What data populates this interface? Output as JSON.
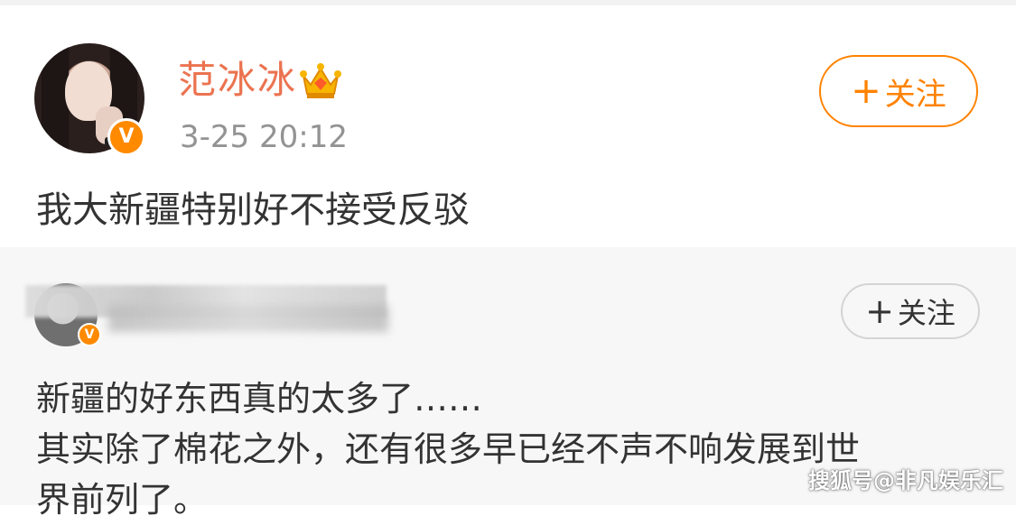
{
  "post": {
    "username": "范冰冰",
    "timestamp": "3-25 20:12",
    "follow_label": "关注",
    "follow_plus": "+",
    "text": "我大新疆特别好不接受反驳",
    "verified_mark": "V"
  },
  "repost": {
    "follow_label": "关注",
    "follow_plus": "+",
    "verified_mark": "V",
    "lines": [
      "新疆的好东西真的太多了……",
      "其实除了棉花之外，还有很多早已经不声不响发展到世",
      "界前列了。"
    ]
  },
  "watermark": "搜狐号@非凡娱乐汇",
  "colors": {
    "username": "#eb7350",
    "follow_border": "#ff8200",
    "verified_badge": "#ff8a00",
    "repost_bg": "#f7f7f7"
  },
  "icons": {
    "crown": "crown-icon",
    "verified": "verified-v-icon",
    "plus": "plus-icon"
  }
}
